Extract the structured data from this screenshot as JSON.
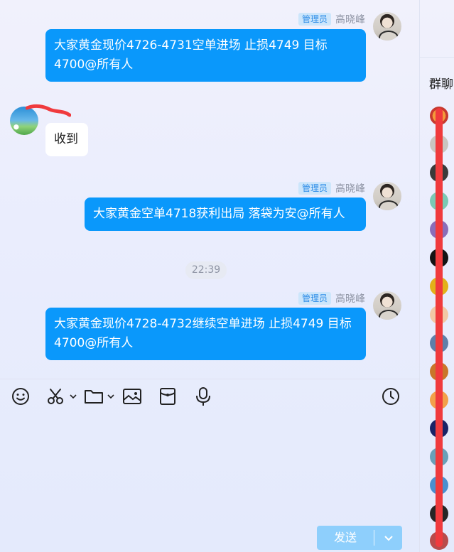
{
  "messages": [
    {
      "badge": "管理员",
      "sender": "高晓峰",
      "text": "大家黄金现价4726-4731空单进场 止损4749  目标4700@所有人"
    },
    {
      "sender": "",
      "text": "收到"
    },
    {
      "badge": "管理员",
      "sender": "高晓峰",
      "text": "大家黄金空单4718获利出局 落袋为安@所有人"
    },
    {
      "badge": "管理员",
      "sender": "高晓峰",
      "text": "大家黄金现价4728-4732继续空单进场 止损4749  目标4700@所有人"
    }
  ],
  "time_divider": "22:39",
  "toolbar": {
    "icons": [
      "emoji-icon",
      "scissors-icon",
      "folder-icon",
      "image-icon",
      "red-packet-icon",
      "microphone-icon",
      "history-icon"
    ]
  },
  "send_button": {
    "label": "发送"
  },
  "side_panel": {
    "title": "群聊"
  },
  "colors": {
    "bubble_out": "#0a98fb",
    "bubble_in": "#ffffff",
    "badge_bg": "#cde6fb",
    "annotation_red": "#f03a3d",
    "send_disabled": "#8ecffc"
  }
}
